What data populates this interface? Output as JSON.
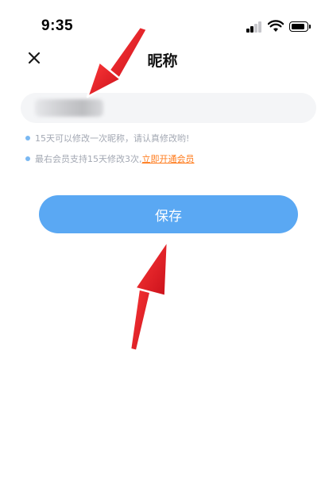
{
  "status_bar": {
    "time": "9:35",
    "icons": [
      "signal-icon",
      "wifi-icon",
      "battery-icon"
    ]
  },
  "nav": {
    "title": "昵称",
    "close_icon": "close-icon"
  },
  "nickname": {
    "value_state": "blurred"
  },
  "tips": {
    "line1": "15天可以修改一次昵称，请认真修改哟!",
    "line2_text": "最右会员支持15天修改3次,",
    "line2_link": "立即开通会员"
  },
  "save_button": {
    "label": "保存"
  },
  "colors": {
    "accent": "#5aa8f3",
    "tip_text": "#a3a8b3",
    "tip_bullet": "#7ab8f2",
    "link": "#ff7a1a",
    "arrow": "#e8202a",
    "input_bg": "#f4f5f7"
  }
}
